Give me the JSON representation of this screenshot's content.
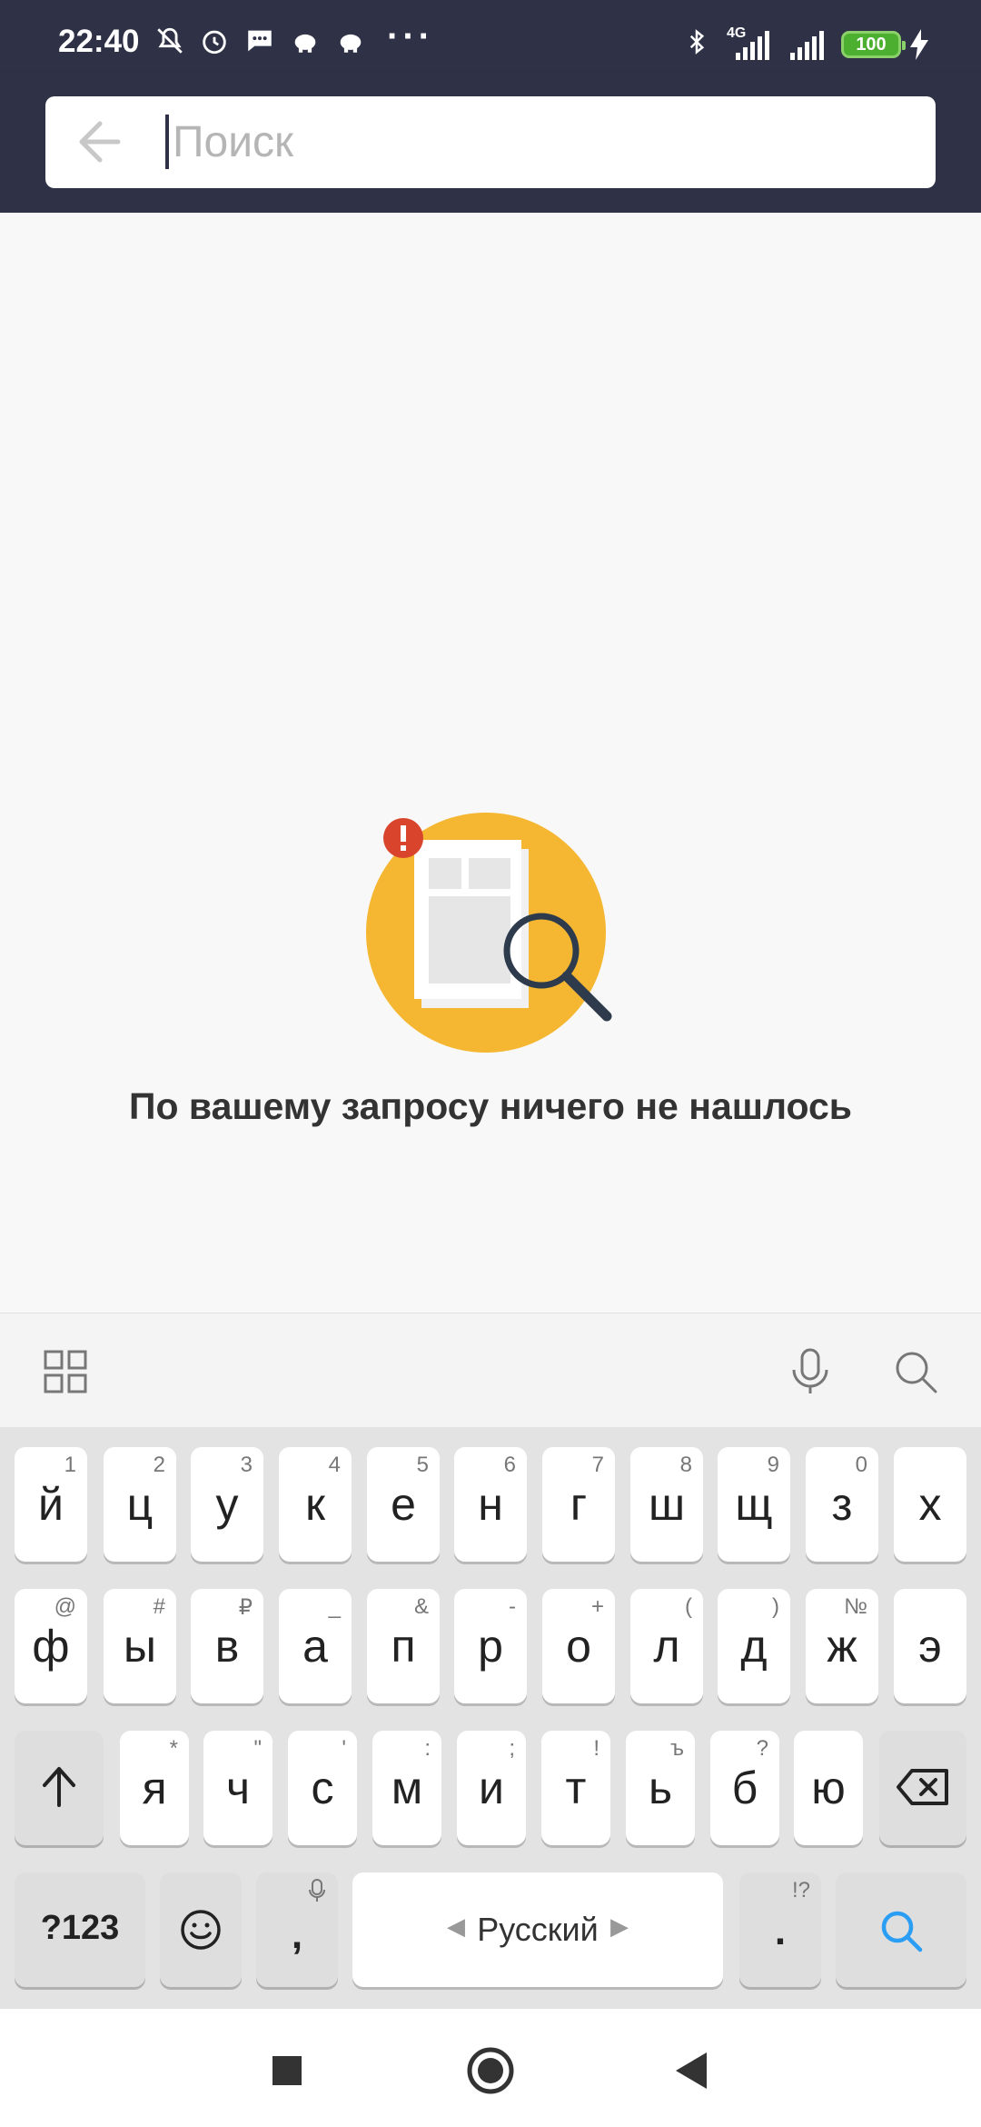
{
  "status_bar": {
    "time": "22:40",
    "battery": "100",
    "network": "4G"
  },
  "header": {
    "search_placeholder": "Поиск",
    "back_icon": "arrow-left-icon"
  },
  "content": {
    "empty_message": "По вашему запросу ничего не нашлось",
    "colors": {
      "accent": "#f5b731",
      "alert": "#d9452c",
      "header": "#2f3146"
    }
  },
  "keyboard": {
    "row1": [
      {
        "char": "й",
        "hint": "1"
      },
      {
        "char": "ц",
        "hint": "2"
      },
      {
        "char": "у",
        "hint": "3"
      },
      {
        "char": "к",
        "hint": "4"
      },
      {
        "char": "е",
        "hint": "5"
      },
      {
        "char": "н",
        "hint": "6"
      },
      {
        "char": "г",
        "hint": "7"
      },
      {
        "char": "ш",
        "hint": "8"
      },
      {
        "char": "щ",
        "hint": "9"
      },
      {
        "char": "з",
        "hint": "0"
      },
      {
        "char": "х",
        "hint": ""
      }
    ],
    "row2": [
      {
        "char": "ф",
        "hint": "@"
      },
      {
        "char": "ы",
        "hint": "#"
      },
      {
        "char": "в",
        "hint": "₽"
      },
      {
        "char": "а",
        "hint": "_"
      },
      {
        "char": "п",
        "hint": "&"
      },
      {
        "char": "р",
        "hint": "-"
      },
      {
        "char": "о",
        "hint": "+"
      },
      {
        "char": "л",
        "hint": "("
      },
      {
        "char": "д",
        "hint": ")"
      },
      {
        "char": "ж",
        "hint": "№"
      },
      {
        "char": "э",
        "hint": ""
      }
    ],
    "row3": [
      {
        "char": "я",
        "hint": "*"
      },
      {
        "char": "ч",
        "hint": "\""
      },
      {
        "char": "с",
        "hint": "'"
      },
      {
        "char": "м",
        "hint": ":"
      },
      {
        "char": "и",
        "hint": ";"
      },
      {
        "char": "т",
        "hint": "!"
      },
      {
        "char": "ь",
        "hint": "ъ"
      },
      {
        "char": "б",
        "hint": "?"
      },
      {
        "char": "ю",
        "hint": ""
      }
    ],
    "symbols_label": "?123",
    "comma": ",",
    "space_label": "Русский",
    "period": ".",
    "period_hint": "!?"
  }
}
